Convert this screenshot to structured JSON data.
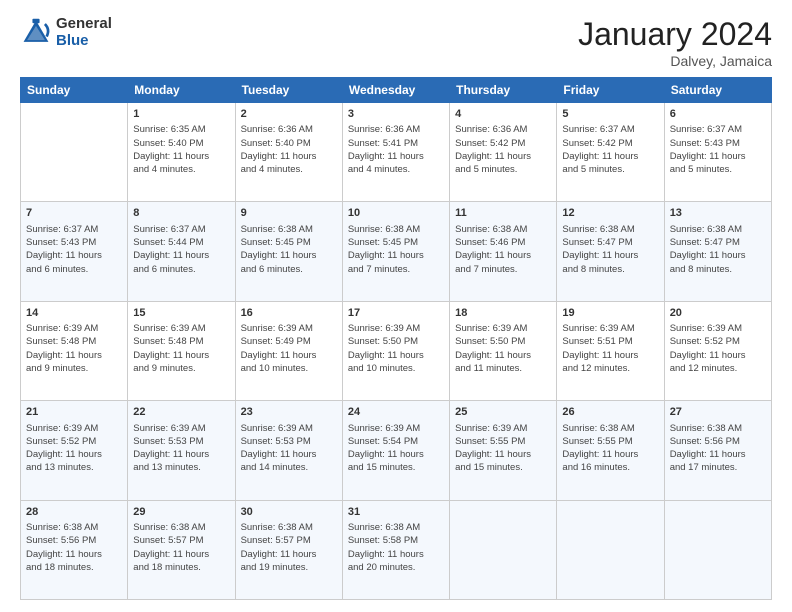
{
  "header": {
    "logo_general": "General",
    "logo_blue": "Blue",
    "month_title": "January 2024",
    "location": "Dalvey, Jamaica"
  },
  "weekdays": [
    "Sunday",
    "Monday",
    "Tuesday",
    "Wednesday",
    "Thursday",
    "Friday",
    "Saturday"
  ],
  "weeks": [
    [
      {
        "day": "",
        "info": ""
      },
      {
        "day": "1",
        "info": "Sunrise: 6:35 AM\nSunset: 5:40 PM\nDaylight: 11 hours\nand 4 minutes."
      },
      {
        "day": "2",
        "info": "Sunrise: 6:36 AM\nSunset: 5:40 PM\nDaylight: 11 hours\nand 4 minutes."
      },
      {
        "day": "3",
        "info": "Sunrise: 6:36 AM\nSunset: 5:41 PM\nDaylight: 11 hours\nand 4 minutes."
      },
      {
        "day": "4",
        "info": "Sunrise: 6:36 AM\nSunset: 5:42 PM\nDaylight: 11 hours\nand 5 minutes."
      },
      {
        "day": "5",
        "info": "Sunrise: 6:37 AM\nSunset: 5:42 PM\nDaylight: 11 hours\nand 5 minutes."
      },
      {
        "day": "6",
        "info": "Sunrise: 6:37 AM\nSunset: 5:43 PM\nDaylight: 11 hours\nand 5 minutes."
      }
    ],
    [
      {
        "day": "7",
        "info": "Sunrise: 6:37 AM\nSunset: 5:43 PM\nDaylight: 11 hours\nand 6 minutes."
      },
      {
        "day": "8",
        "info": "Sunrise: 6:37 AM\nSunset: 5:44 PM\nDaylight: 11 hours\nand 6 minutes."
      },
      {
        "day": "9",
        "info": "Sunrise: 6:38 AM\nSunset: 5:45 PM\nDaylight: 11 hours\nand 6 minutes."
      },
      {
        "day": "10",
        "info": "Sunrise: 6:38 AM\nSunset: 5:45 PM\nDaylight: 11 hours\nand 7 minutes."
      },
      {
        "day": "11",
        "info": "Sunrise: 6:38 AM\nSunset: 5:46 PM\nDaylight: 11 hours\nand 7 minutes."
      },
      {
        "day": "12",
        "info": "Sunrise: 6:38 AM\nSunset: 5:47 PM\nDaylight: 11 hours\nand 8 minutes."
      },
      {
        "day": "13",
        "info": "Sunrise: 6:38 AM\nSunset: 5:47 PM\nDaylight: 11 hours\nand 8 minutes."
      }
    ],
    [
      {
        "day": "14",
        "info": "Sunrise: 6:39 AM\nSunset: 5:48 PM\nDaylight: 11 hours\nand 9 minutes."
      },
      {
        "day": "15",
        "info": "Sunrise: 6:39 AM\nSunset: 5:48 PM\nDaylight: 11 hours\nand 9 minutes."
      },
      {
        "day": "16",
        "info": "Sunrise: 6:39 AM\nSunset: 5:49 PM\nDaylight: 11 hours\nand 10 minutes."
      },
      {
        "day": "17",
        "info": "Sunrise: 6:39 AM\nSunset: 5:50 PM\nDaylight: 11 hours\nand 10 minutes."
      },
      {
        "day": "18",
        "info": "Sunrise: 6:39 AM\nSunset: 5:50 PM\nDaylight: 11 hours\nand 11 minutes."
      },
      {
        "day": "19",
        "info": "Sunrise: 6:39 AM\nSunset: 5:51 PM\nDaylight: 11 hours\nand 12 minutes."
      },
      {
        "day": "20",
        "info": "Sunrise: 6:39 AM\nSunset: 5:52 PM\nDaylight: 11 hours\nand 12 minutes."
      }
    ],
    [
      {
        "day": "21",
        "info": "Sunrise: 6:39 AM\nSunset: 5:52 PM\nDaylight: 11 hours\nand 13 minutes."
      },
      {
        "day": "22",
        "info": "Sunrise: 6:39 AM\nSunset: 5:53 PM\nDaylight: 11 hours\nand 13 minutes."
      },
      {
        "day": "23",
        "info": "Sunrise: 6:39 AM\nSunset: 5:53 PM\nDaylight: 11 hours\nand 14 minutes."
      },
      {
        "day": "24",
        "info": "Sunrise: 6:39 AM\nSunset: 5:54 PM\nDaylight: 11 hours\nand 15 minutes."
      },
      {
        "day": "25",
        "info": "Sunrise: 6:39 AM\nSunset: 5:55 PM\nDaylight: 11 hours\nand 15 minutes."
      },
      {
        "day": "26",
        "info": "Sunrise: 6:38 AM\nSunset: 5:55 PM\nDaylight: 11 hours\nand 16 minutes."
      },
      {
        "day": "27",
        "info": "Sunrise: 6:38 AM\nSunset: 5:56 PM\nDaylight: 11 hours\nand 17 minutes."
      }
    ],
    [
      {
        "day": "28",
        "info": "Sunrise: 6:38 AM\nSunset: 5:56 PM\nDaylight: 11 hours\nand 18 minutes."
      },
      {
        "day": "29",
        "info": "Sunrise: 6:38 AM\nSunset: 5:57 PM\nDaylight: 11 hours\nand 18 minutes."
      },
      {
        "day": "30",
        "info": "Sunrise: 6:38 AM\nSunset: 5:57 PM\nDaylight: 11 hours\nand 19 minutes."
      },
      {
        "day": "31",
        "info": "Sunrise: 6:38 AM\nSunset: 5:58 PM\nDaylight: 11 hours\nand 20 minutes."
      },
      {
        "day": "",
        "info": ""
      },
      {
        "day": "",
        "info": ""
      },
      {
        "day": "",
        "info": ""
      }
    ]
  ]
}
